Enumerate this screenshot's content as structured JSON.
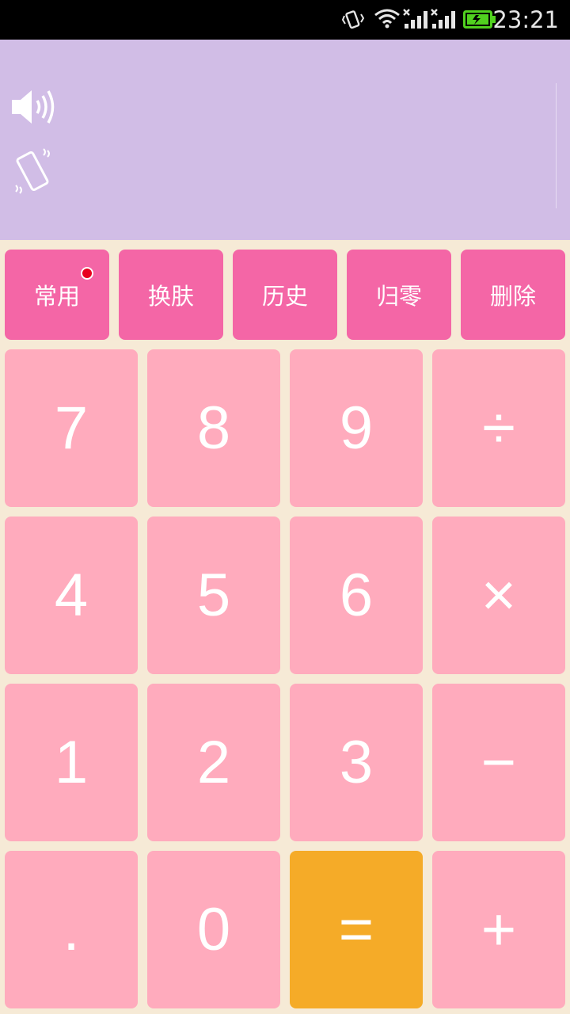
{
  "status_bar": {
    "time": "23:21",
    "icons": [
      "vibrate-icon",
      "wifi-icon",
      "signal-1-icon",
      "signal-2-icon",
      "battery-charging-icon"
    ],
    "battery_color": "#51d21f"
  },
  "display": {
    "expression": "",
    "result": "",
    "icons": [
      "speaker-icon",
      "vibrate-phone-icon"
    ]
  },
  "function_row": [
    {
      "label": "常用",
      "badge": true
    },
    {
      "label": "换肤",
      "badge": false
    },
    {
      "label": "历史",
      "badge": false
    },
    {
      "label": "归零",
      "badge": false
    },
    {
      "label": "删除",
      "badge": false
    }
  ],
  "keypad": [
    [
      "7",
      "8",
      "9",
      "÷"
    ],
    [
      "4",
      "5",
      "6",
      "×"
    ],
    [
      "1",
      "2",
      "3",
      "−"
    ],
    [
      ".",
      "0",
      "=",
      "+"
    ]
  ],
  "colors": {
    "background": "#f6ead6",
    "display": "#d1bde6",
    "function_button": "#f466a6",
    "key_button": "#ffabbd",
    "equals_button": "#f5ab28",
    "badge": "#e8001e"
  }
}
